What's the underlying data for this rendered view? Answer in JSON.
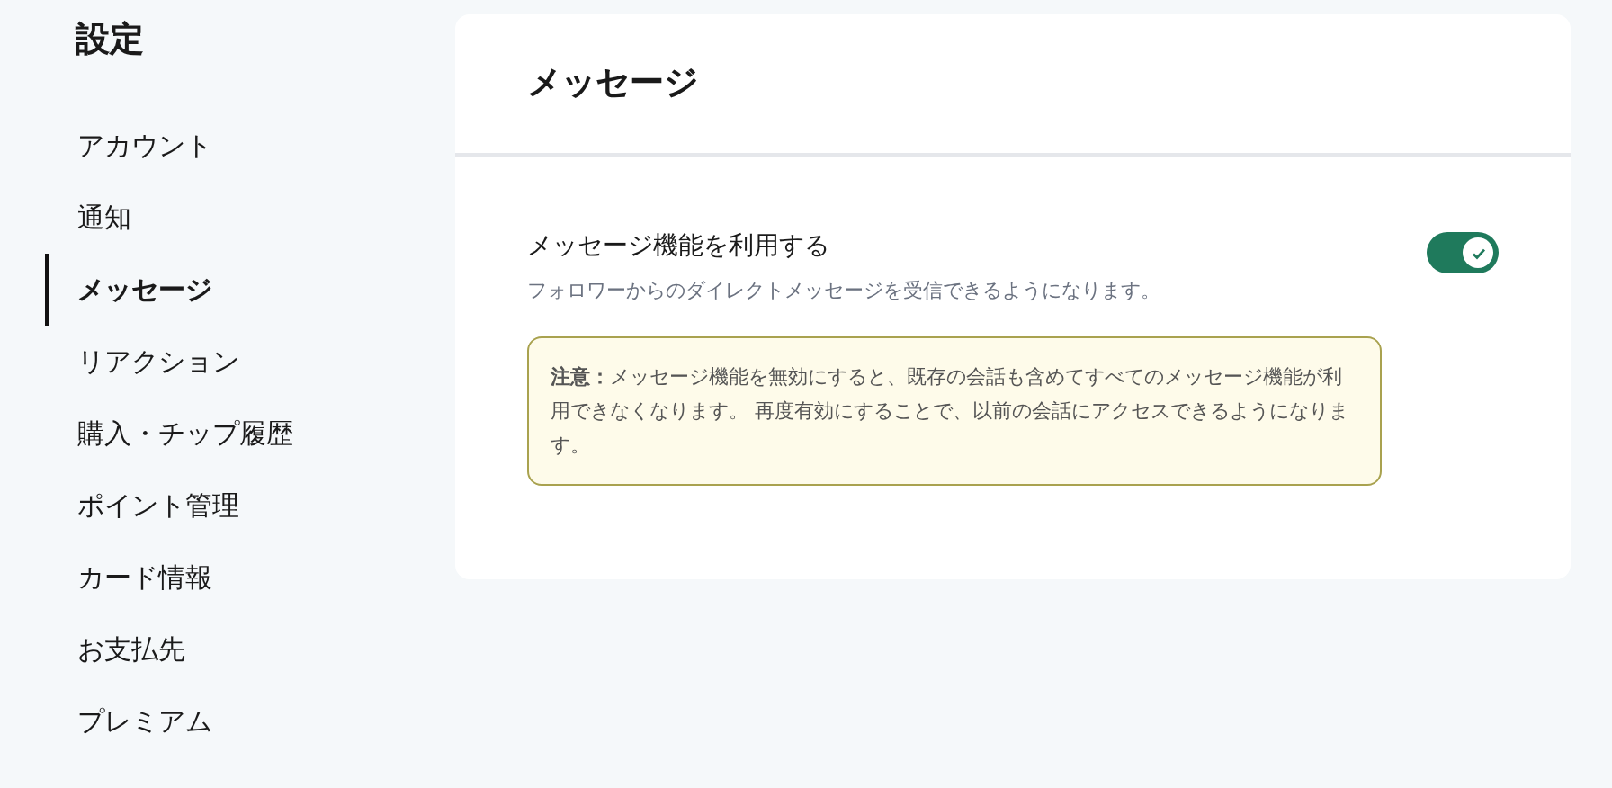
{
  "sidebar": {
    "title": "設定",
    "items": [
      {
        "label": "アカウント",
        "selected": false
      },
      {
        "label": "通知",
        "selected": false
      },
      {
        "label": "メッセージ",
        "selected": true
      },
      {
        "label": "リアクション",
        "selected": false
      },
      {
        "label": "購入・チップ履歴",
        "selected": false
      },
      {
        "label": "ポイント管理",
        "selected": false
      },
      {
        "label": "カード情報",
        "selected": false
      },
      {
        "label": "お支払先",
        "selected": false
      },
      {
        "label": "プレミアム",
        "selected": false
      }
    ]
  },
  "panel": {
    "title": "メッセージ",
    "setting": {
      "label": "メッセージ機能を利用する",
      "description": "フォロワーからのダイレクトメッセージを受信できるようになります。",
      "on": true
    },
    "notice": "**注意：**メッセージ機能を無効にすると、既存の会話も含めてすべてのメッセージ機能が利用できなくなります。 再度有効にすることで、以前の会話にアクセスできるようになります。"
  }
}
